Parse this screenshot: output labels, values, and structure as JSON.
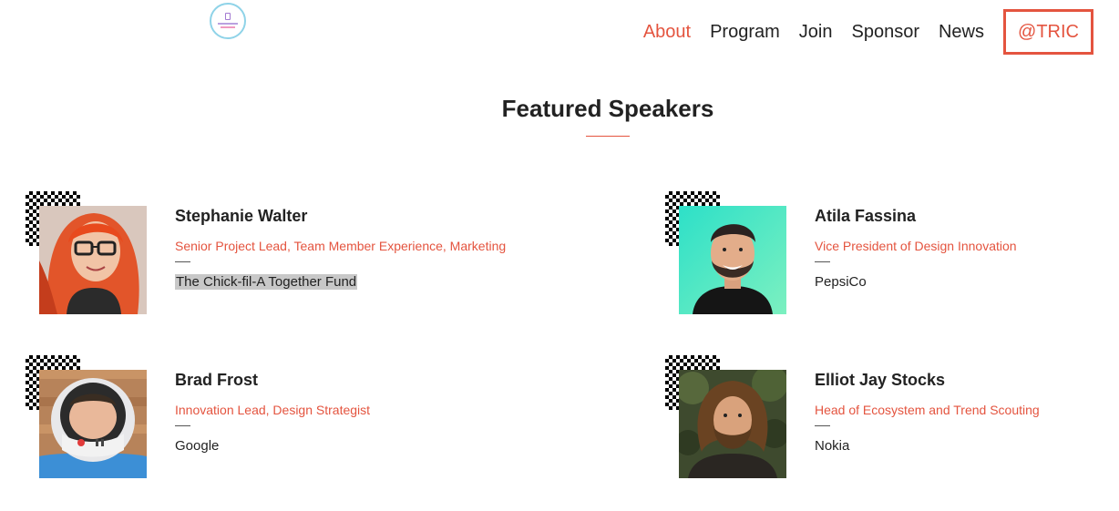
{
  "nav": {
    "items": [
      {
        "label": "About",
        "active": true
      },
      {
        "label": "Program",
        "active": false
      },
      {
        "label": "Join",
        "active": false
      },
      {
        "label": "Sponsor",
        "active": false
      },
      {
        "label": "News",
        "active": false
      }
    ],
    "cta_label": "@TRIC"
  },
  "section": {
    "title": "Featured Speakers"
  },
  "speakers": [
    {
      "name": "Stephanie Walter",
      "role": "Senior Project Lead, Team Member Experience, Marketing",
      "company": "The Chick-fil-A Together Fund",
      "photo_icon": "avatar-red-hair-glasses"
    },
    {
      "name": "Atila Fassina",
      "role": "Vice President of Design Innovation",
      "company": "PepsiCo",
      "photo_icon": "avatar-bearded-man-teal"
    },
    {
      "name": "Brad Frost",
      "role": "Innovation Lead, Design Strategist",
      "company": "Google",
      "photo_icon": "avatar-astronaut-helmet"
    },
    {
      "name": "Elliot Jay Stocks",
      "role": "Head of Ecosystem and Trend Scouting",
      "company": "Nokia",
      "photo_icon": "avatar-curly-hair-forest"
    }
  ],
  "colors": {
    "accent": "#e4543f",
    "text": "#222222",
    "highlight": "#c8c8c8"
  }
}
